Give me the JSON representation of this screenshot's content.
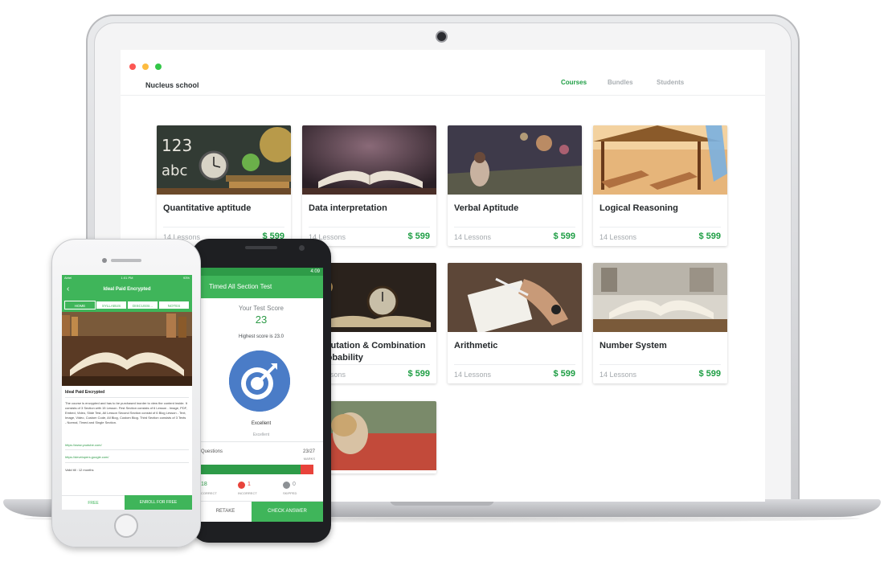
{
  "desktop": {
    "app_title": "Nucleus school",
    "nav": [
      {
        "label": "Courses",
        "active": true
      },
      {
        "label": "Bundles",
        "active": false
      },
      {
        "label": "Students",
        "active": false
      }
    ],
    "courses": [
      {
        "title": "Quantitative aptitude",
        "lessons": "14 Lessons",
        "price": "$ 599"
      },
      {
        "title": "Data interpretation",
        "lessons": "14 Lessons",
        "price": "$ 599"
      },
      {
        "title": "Verbal Aptitude",
        "lessons": "14 Lessons",
        "price": "$ 599"
      },
      {
        "title": "Logical Reasoning",
        "lessons": "14 Lessons",
        "price": "$ 599"
      },
      {
        "title": "Permutation & Combination & Probability",
        "lessons": "14 Lessons",
        "price": "$ 599"
      },
      {
        "title": "Arithmetic",
        "lessons": "14 Lessons",
        "price": "$ 599"
      },
      {
        "title": "Number System",
        "lessons": "14 Lessons",
        "price": "$ 599"
      }
    ]
  },
  "android": {
    "status_time": "4:09",
    "title": "Timed All Section Test",
    "score_label": "Your Test Score",
    "score": "23",
    "highest": "Highest score is 23.0",
    "rating": "Excellent",
    "rating_sub": "Excellent",
    "questions_label": "Questions",
    "questions_value": "23/27",
    "marks_label": "MARKS",
    "correct_value": "18",
    "correct_label": "CORRECT",
    "incorrect_value": "1",
    "incorrect_label": "INCORRECT",
    "skipped_value": "0",
    "skipped_label": "SKIPPED",
    "retake_label": "RETAKE",
    "check_label": "CHECK ANSWER"
  },
  "iphone": {
    "carrier": "Airtel",
    "time": "1:01 PM",
    "battery": "93%",
    "title": "Ideal Paid Encrypted",
    "tabs": [
      "HOME",
      "SYLLABUS",
      "DISCUSSI...",
      "NOTES"
    ],
    "course_title": "Ideal Paid Encrypted",
    "description": "The course is encrypted and has to be purchased inorder to view the content inside. It consists of 3 Section with 15 Lesson. First Section consists of 6 Lesson - Image, PDF, Embed, Video, Slide Test, All Lesson Second Section consist of 6 Blog Lesson - Text, Image, Video, Custom Code, All Blog, Custom Blog. Third Section consists of 3 Texts - Normal, Timed and Single Section.",
    "link1": "https://www.youtube.com/",
    "link2": "https://developers.google.com/",
    "valid": "Valid till : 12 months",
    "free_label": "FREE",
    "enroll_label": "ENROLL FOR FREE"
  },
  "colors": {
    "accent": "#3fb55a",
    "price": "#1e9e44",
    "target_blue": "#4a7cc7",
    "incorrect": "#e8433b"
  }
}
